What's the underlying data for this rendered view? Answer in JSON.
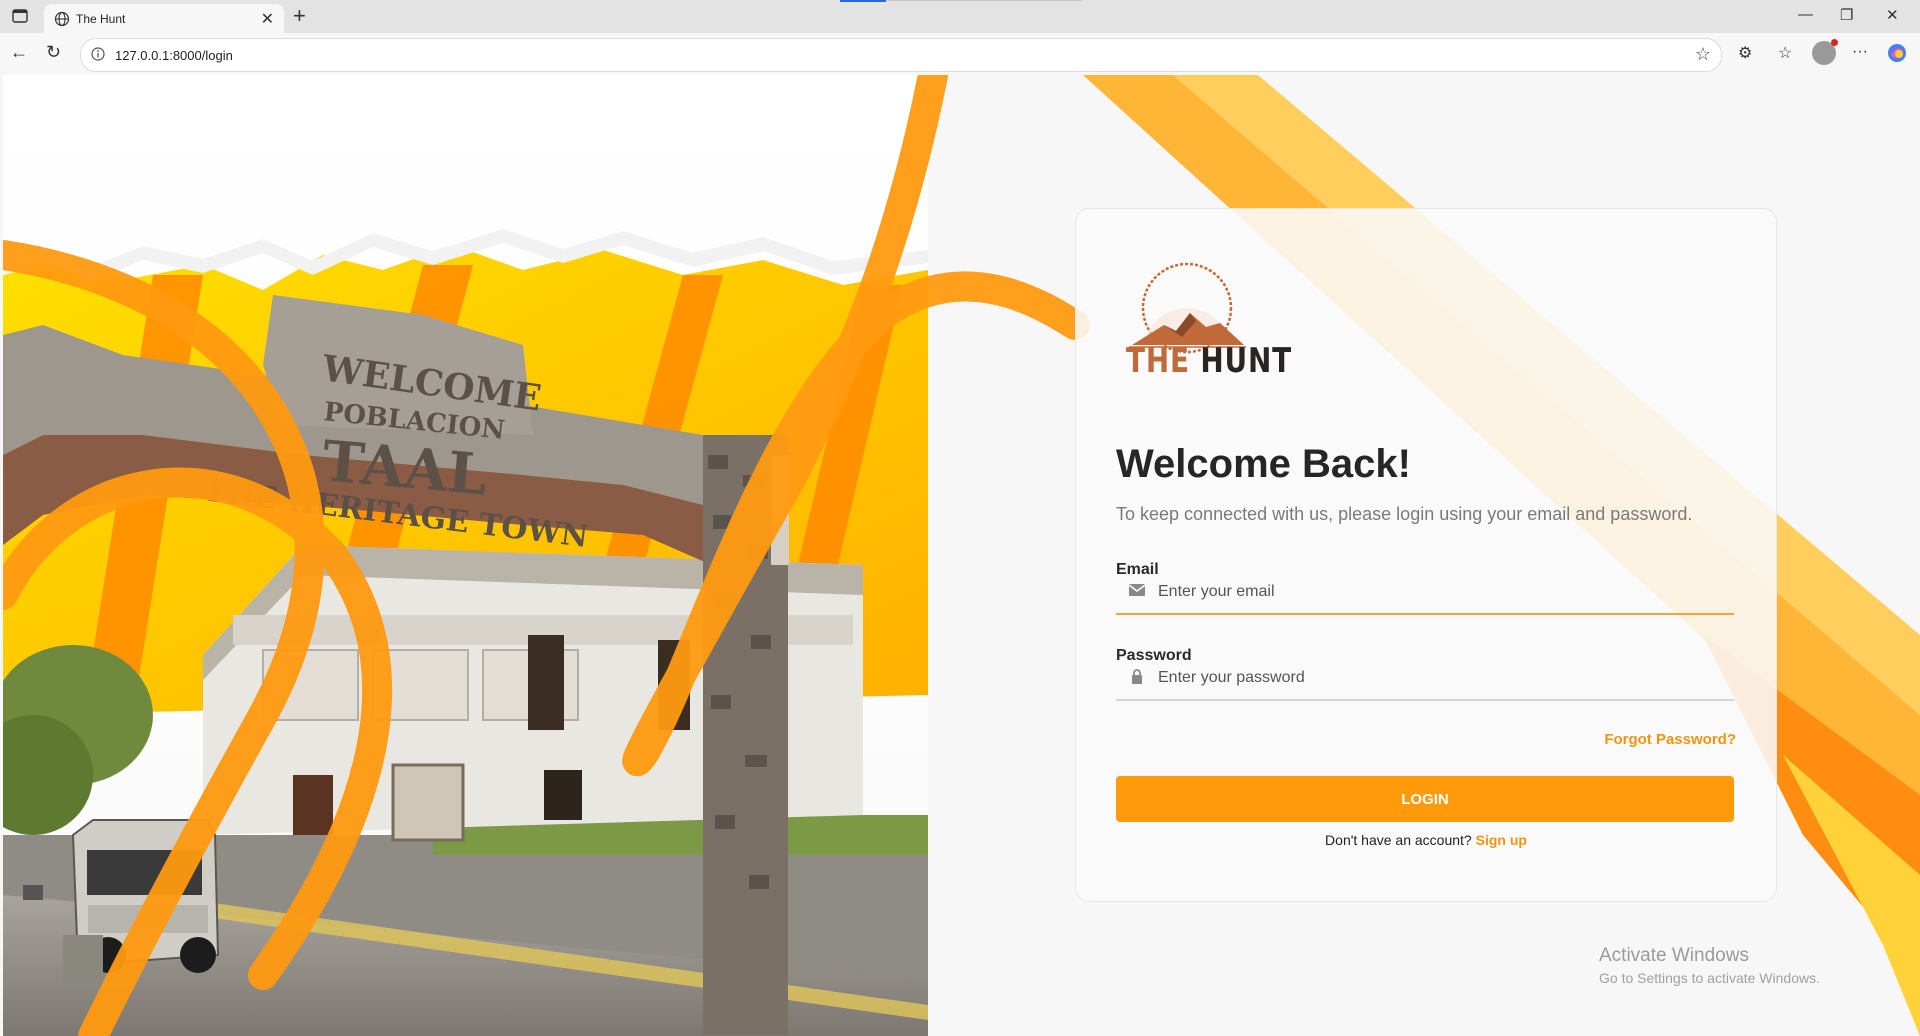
{
  "browser": {
    "tab_title": "The Hunt",
    "tab_close": "✕",
    "new_tab": "+",
    "url": "127.0.0.1:8000/login",
    "window_controls": {
      "minimize": "—",
      "restore": "❐",
      "close": "✕"
    },
    "menu_icon": "···"
  },
  "hero": {
    "sign_line1": "WELCOME",
    "sign_line2": "POBLACION",
    "sign_line3": "TAAL",
    "sign_line4": "THE HERITAGE TOWN"
  },
  "logo": {
    "text_the": "THE",
    "text_hunt": "HUNT"
  },
  "login": {
    "heading": "Welcome Back!",
    "subtitle": "To keep connected with us, please login using your email and password.",
    "email_label": "Email",
    "email_placeholder": "Enter your email",
    "password_label": "Password",
    "password_placeholder": "Enter your password",
    "forgot": "Forgot Password?",
    "button": "LOGIN",
    "no_account": "Don't have an account?",
    "signup": "Sign up"
  },
  "watermark": {
    "line1": "Activate Windows",
    "line2": "Go to Settings to activate Windows."
  },
  "colors": {
    "accent": "#ff9b0a",
    "accent_dark": "#f39411",
    "yellow": "#ffd200",
    "brand_brown": "#c06a3a"
  }
}
